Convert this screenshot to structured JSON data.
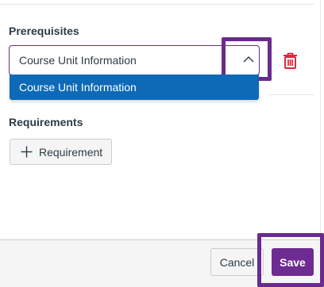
{
  "prerequisites": {
    "heading": "Prerequisites",
    "selected_value": "Course Unit Information",
    "dropdown_options": [
      "Course Unit Information"
    ]
  },
  "requirements": {
    "heading": "Requirements",
    "add_button_label": "Requirement"
  },
  "footer": {
    "cancel_label": "Cancel",
    "save_label": "Save"
  },
  "colors": {
    "highlight": "#6a2a8e",
    "selected_option": "#0e6ab7",
    "delete": "#e0061f",
    "save": "#6e2b91"
  },
  "icons": [
    "chevron-up-icon",
    "trash-icon",
    "plus-icon"
  ]
}
